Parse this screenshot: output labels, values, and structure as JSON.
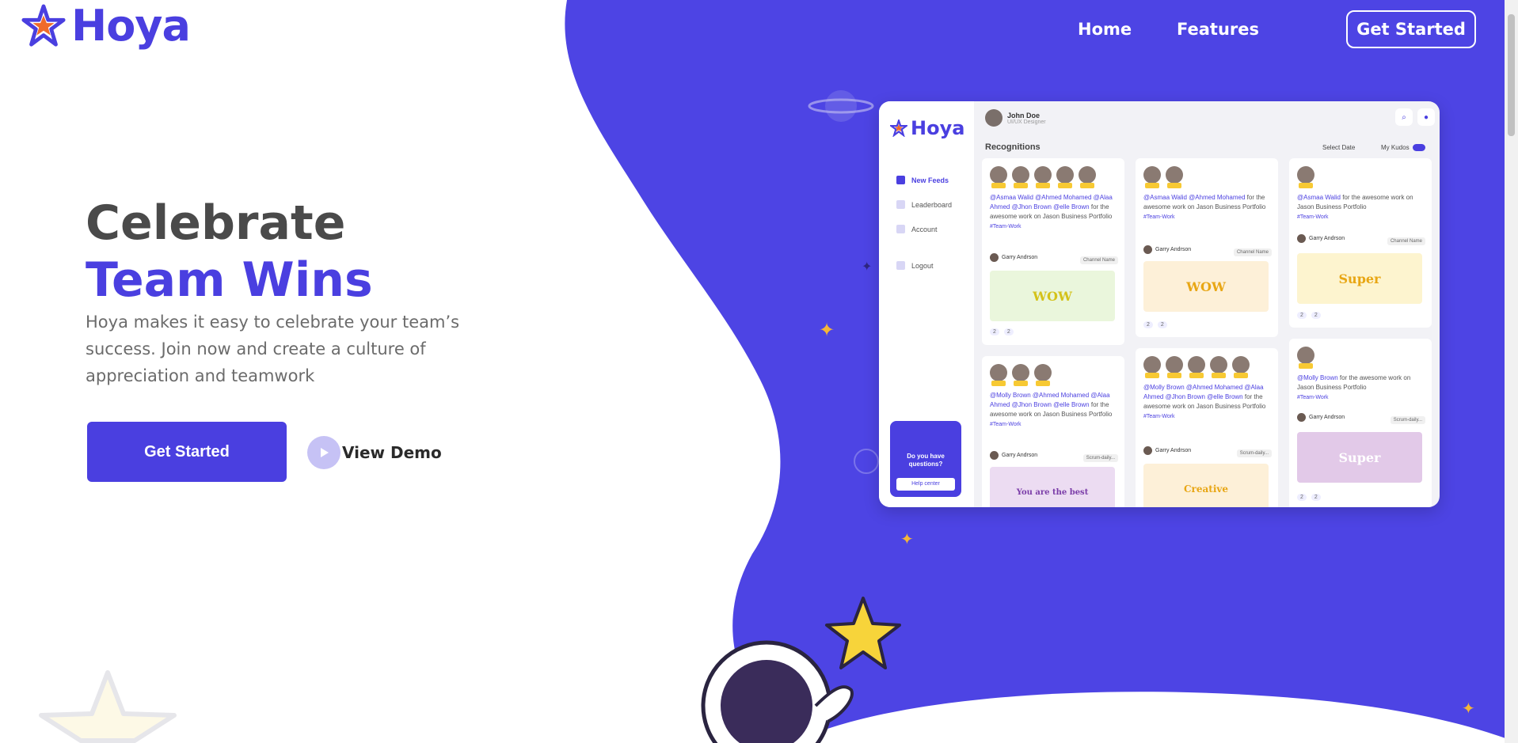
{
  "brand": {
    "name": "Hoya",
    "accent": "#4a3fe0"
  },
  "nav": {
    "items": [
      "Home",
      "Features"
    ],
    "cta": "Get Started"
  },
  "hero": {
    "title_line1": "Celebrate",
    "title_line2": "Team Wins",
    "subtitle": "Hoya makes it easy to celebrate your team’s success. Join now and create a culture of appreciation and teamwork",
    "primary_button": "Get Started",
    "demo_button": "View Demo"
  },
  "mockup": {
    "brand": "Hoya",
    "user_name": "John Doe",
    "user_role": "UI/UX Designer",
    "section_title": "Recognitions",
    "filter_label": "Select Date",
    "kudos_label": "My Kudos",
    "sidebar": [
      "New Feeds",
      "Leaderboard",
      "Account",
      "Logout"
    ],
    "help_text": "Do you have questions?",
    "help_button": "Help center",
    "cards": [
      {
        "mentions": "@Asmaa Walid @Ahmed Mohamed @Alaa Ahmed @Jhon Brown @elle Brown",
        "text": "for the awesome work on Jason Business Portfolio",
        "tag": "#Team-Work",
        "user": "Garry Andrson",
        "chip": "Channel Name",
        "sticker": "WOW",
        "r1": "2",
        "r2": "2"
      },
      {
        "mentions": "@Asmaa Walid @Ahmed Mohamed",
        "text": "for the awesome work on Jason Business Portfolio",
        "tag": "#Team-Work",
        "user": "Garry Andrson",
        "chip": "Channel Name",
        "sticker": "WOW",
        "r1": "2",
        "r2": "2"
      },
      {
        "mentions": "@Asmaa Walid",
        "text": "for the awesome work on Jason Business Portfolio",
        "tag": "#Team-Work",
        "user": "Garry Andrson",
        "chip": "Channel Name",
        "sticker": "Super",
        "r1": "2",
        "r2": "2"
      },
      {
        "mentions": "@Molly Brown @Ahmed Mohamed @Alaa Ahmed @Jhon Brown @elle Brown",
        "text": "for the awesome work on Jason Business Portfolio",
        "tag": "#Team-Work",
        "user": "Garry Andrson",
        "chip": "Scrum-daily...",
        "sticker": "You are the best",
        "r1": "",
        "r2": ""
      },
      {
        "mentions": "@Molly Brown @Ahmed Mohamed @Alaa Ahmed @Jhon Brown @elle Brown",
        "text": "for the awesome work on Jason Business Portfolio",
        "tag": "#Team-Work",
        "user": "Garry Andrson",
        "chip": "Scrum-daily...",
        "sticker": "Creative",
        "r1": "",
        "r2": ""
      },
      {
        "mentions": "@Molly Brown",
        "text": "for the awesome work on Jason Business Portfolio",
        "tag": "#Team-Work",
        "user": "Garry Andrson",
        "chip": "Scrum-daily...",
        "sticker": "Super",
        "r1": "2",
        "r2": "2"
      }
    ]
  }
}
